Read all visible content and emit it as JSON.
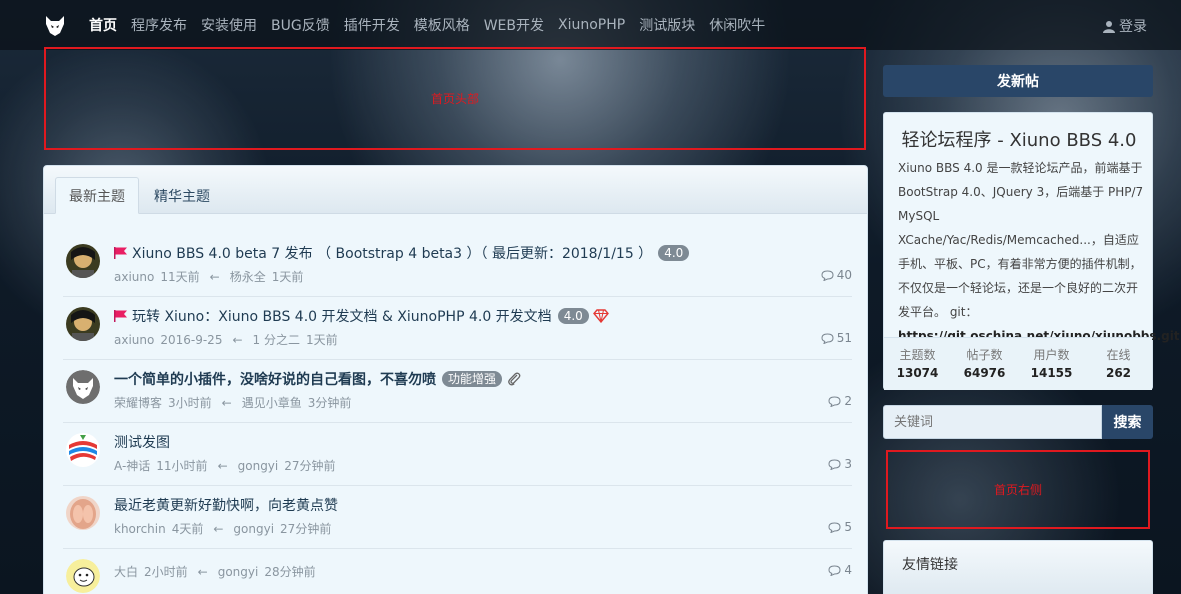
{
  "navbar": {
    "items": [
      "首页",
      "程序发布",
      "安装使用",
      "BUG反馈",
      "插件开发",
      "模板风格",
      "WEB开发",
      "XiunoPHP",
      "测试版块",
      "休闲吹牛"
    ],
    "login": "登录"
  },
  "placeholders": {
    "head": "首页头部",
    "right": "首页右侧"
  },
  "tabs": [
    "最新主题",
    "精华主题"
  ],
  "threads": [
    {
      "title": "Xiuno BBS 4.0 beta 7 发布 （ Bootstrap 4 beta3 ）（ 最后更新：2018/1/15 ）",
      "badge": "4.0",
      "author": "axiuno",
      "time": "11天前",
      "last_user": "杨永全",
      "last_time": "1天前",
      "replies": "40"
    },
    {
      "title": "玩转 Xiuno：Xiuno BBS 4.0 开发文档 & XiunoPHP 4.0 开发文档",
      "badge": "4.0",
      "author": "axiuno",
      "time": "2016-9-25",
      "last_user": "1 分之二",
      "last_time": "1天前",
      "replies": "51"
    },
    {
      "title": "一个简单的小插件，没啥好说的自己看图，不喜勿喷",
      "badge": "功能增强",
      "author": "荣耀博客",
      "time": "3小时前",
      "last_user": "遇见小章鱼",
      "last_time": "3分钟前",
      "replies": "2"
    },
    {
      "title": "测试发图",
      "author": "A-神话",
      "time": "11小时前",
      "last_user": "gongyi",
      "last_time": "27分钟前",
      "replies": "3"
    },
    {
      "title": "最近老黄更新好勤快啊，向老黄点赞",
      "author": "khorchin",
      "time": "4天前",
      "last_user": "gongyi",
      "last_time": "27分钟前",
      "replies": "5"
    },
    {
      "title": "",
      "author": "大白",
      "time": "2小时前",
      "last_user": "gongyi",
      "last_time": "28分钟前",
      "replies": "4"
    }
  ],
  "sidebar": {
    "new_post": "发新帖",
    "title": "轻论坛程序 - Xiuno BBS 4.0",
    "desc": "Xiuno BBS 4.0 是一款轻论坛产品，前端基于 BootStrap 4.0、JQuery 3，后端基于 PHP/7 MySQL XCache/Yac/Redis/Memcached...，自适应手机、平板、PC，有着非常方便的插件机制，不仅仅是一个轻论坛，还是一个良好的二次开发平台。 git：",
    "git": "https://git.oschina.net/xiuno/xiunobbs.git",
    "stats": [
      {
        "label": "主题数",
        "value": "13074"
      },
      {
        "label": "帖子数",
        "value": "64976"
      },
      {
        "label": "用户数",
        "value": "14155"
      },
      {
        "label": "在线",
        "value": "262"
      }
    ],
    "search_placeholder": "关键词",
    "search_button": "搜索",
    "links_title": "友情链接"
  }
}
